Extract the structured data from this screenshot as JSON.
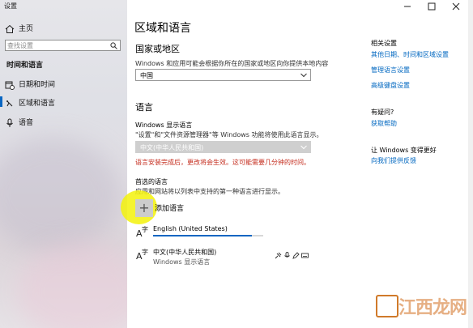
{
  "window": {
    "title": "设置"
  },
  "sidebar": {
    "home_label": "主页",
    "search_placeholder": "查找设置",
    "section_title": "时间和语言",
    "items": [
      {
        "label": "日期和时间",
        "icon": "calendar-clock-icon"
      },
      {
        "label": "区域和语言",
        "icon": "region-language-icon",
        "active": true
      },
      {
        "label": "语音",
        "icon": "microphone-icon"
      }
    ]
  },
  "main": {
    "title": "区域和语言",
    "country": {
      "heading": "国家或地区",
      "description": "Windows 和应用可能会根据你所在的国家或地区向你提供本地内容",
      "selected": "中国"
    },
    "language": {
      "heading": "语言",
      "display_label": "Windows 显示语言",
      "display_desc": "\"设置\"和\"文件资源管理器\"等 Windows 功能将使用此语言显示。",
      "display_selected": "中文(中华人民共和国)",
      "warning": "语言安装完成后，更改将会生效。这可能需要几分钟的时间。",
      "preferred_heading": "首选的语言",
      "preferred_desc": "应用和网站将以列表中支持的第一种语言进行显示。",
      "add_label": "添加语言",
      "list": [
        {
          "name": "English (United States)",
          "sub": "",
          "progress": 0.9
        },
        {
          "name": "中文(中华人民共和国)",
          "sub": "Windows 显示语言"
        }
      ]
    }
  },
  "right": {
    "related_heading": "相关设置",
    "related_links": [
      "其他日期、时间和区域设置",
      "管理语言设置",
      "高级键盘设置"
    ],
    "help_heading": "有疑问?",
    "help_link": "获取帮助",
    "better_heading": "让 Windows 变得更好",
    "feedback_link": "向我们提供反馈"
  },
  "watermark": {
    "text": "江西龙网"
  },
  "colors": {
    "accent": "#0a66c2",
    "link": "#0067c0",
    "warning": "#c42b1c",
    "highlight": "#f3f20a"
  }
}
